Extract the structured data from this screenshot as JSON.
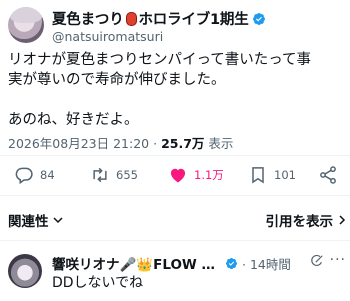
{
  "post": {
    "display_name": "夏色まつり",
    "display_name_suffix": "ホロライブ1期生",
    "handle": "@natsuiromatsuri",
    "body": "リオナが夏色まつりセンパイって書いたって事\n実が尊いので寿命が伸びました。\n\nあのね、好きだよ。",
    "timestamp": "2026年08月23日 21:20",
    "views_count": "25.7万",
    "views_label": "表示"
  },
  "actions": {
    "replies": "84",
    "reposts": "655",
    "likes": "1.1万",
    "bookmarks": "101"
  },
  "colors": {
    "verified": "#1d9bf0",
    "like": "#f91880",
    "muted": "#536471"
  },
  "replies_section": {
    "relevance_label": "関連性",
    "quote_label": "引用を表示"
  },
  "reply": {
    "display_name": "響咲リオナ🎤👑FLOW G...",
    "time": "· 14時間",
    "more": "···",
    "text": "DDしないでね"
  }
}
